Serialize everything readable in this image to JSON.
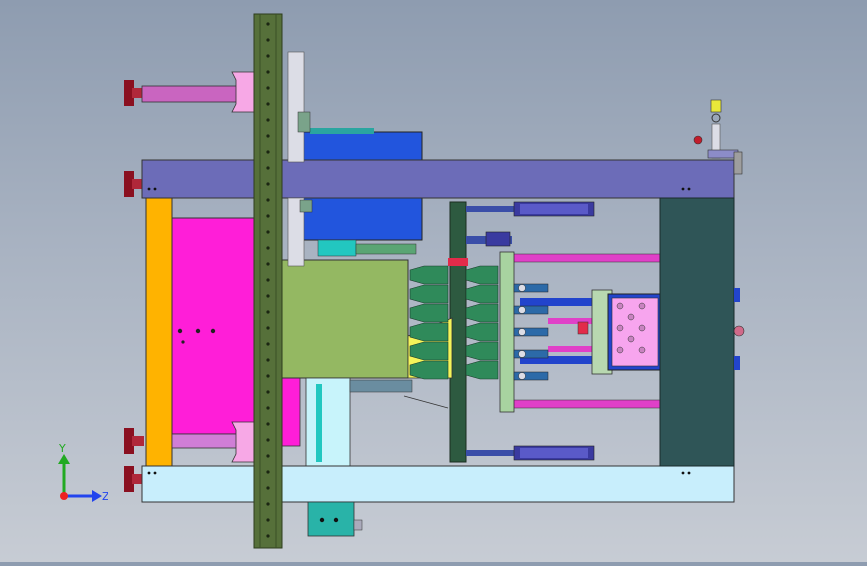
{
  "viewport": {
    "background_top": "#8e9cb0",
    "background_bottom": "#c7ccd4"
  },
  "triad": {
    "y_label": "Y",
    "z_label": "Z",
    "y_color": "#22aa22",
    "z_color": "#2244ee",
    "origin_color": "#ee2222"
  },
  "colors": {
    "top_beam": "#6c6cb8",
    "bottom_beam": "#c8eefc",
    "tie_bar": "#56703a",
    "moving_platen": "#2f5557",
    "orange_plate": "#ffb300",
    "magenta_plate": "#ff1ed8",
    "green_block": "#94b862",
    "blue_block": "#2255dd",
    "yellow_nozzle": "#f4f45a",
    "pink_plate": "#f7a5ee",
    "dark_red_knob": "#8a1020"
  }
}
